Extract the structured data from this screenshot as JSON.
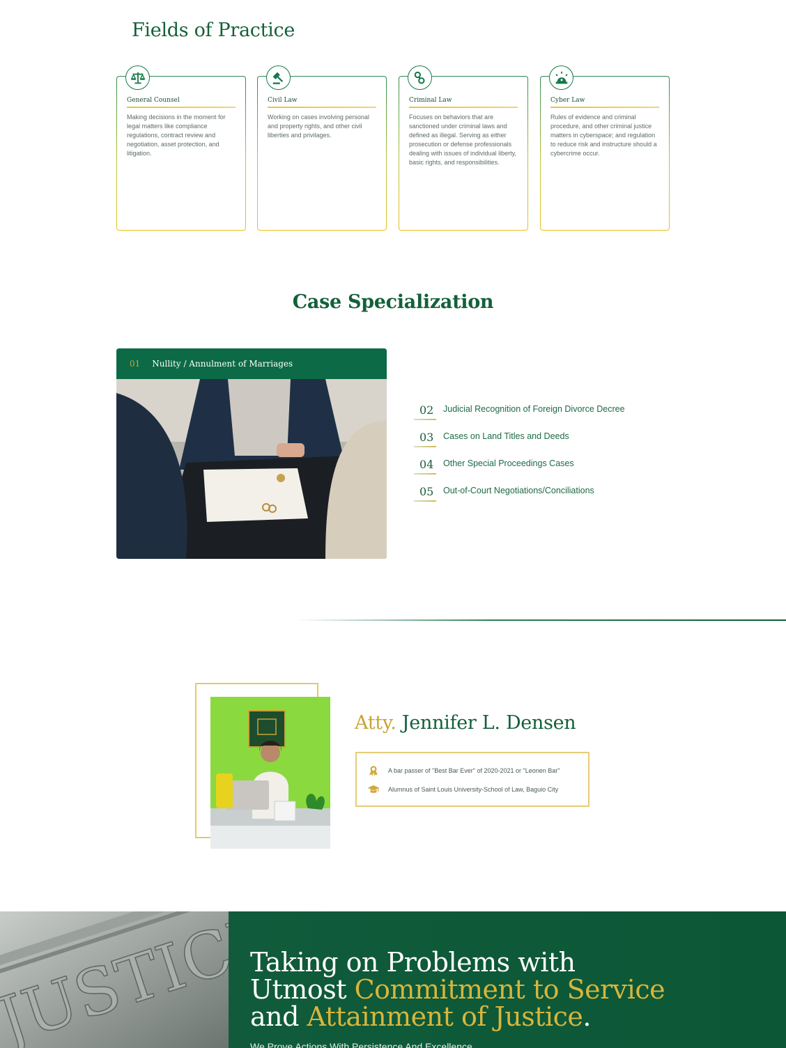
{
  "fields_of_practice": {
    "title": "Fields of Practice",
    "cards": [
      {
        "icon": "scales-icon",
        "title": "General Counsel",
        "text": "Making decisions in the moment for legal matters like compliance regulations, contract review and negotiation, asset protection, and litigation."
      },
      {
        "icon": "gavel-icon",
        "title": "Civil Law",
        "text": "Working on cases involving personal and property rights, and other civil liberties and privilages."
      },
      {
        "icon": "handcuffs-icon",
        "title": "Criminal Law",
        "text": "Focuses on behaviors that are sanctioned under criminal laws and defined as illegal. Serving as either prosecution or defense professionals dealing with issues of individual liberty, basic rights, and responsibilities."
      },
      {
        "icon": "alarm-siren-icon",
        "title": "Cyber Law",
        "text": "Rules of evidence and criminal procedure, and other criminal justice matters in cyberspace; and regulation to reduce risk and instructure should a cybercrime occur."
      }
    ]
  },
  "case_specialization": {
    "title": "Case Specialization",
    "active": {
      "number": "01",
      "label": "Nullity / Annulment of Marriages"
    },
    "items": [
      {
        "number": "02",
        "label": "Judicial Recognition of Foreign Divorce Decree"
      },
      {
        "number": "03",
        "label": "Cases on Land Titles and Deeds"
      },
      {
        "number": "04",
        "label": "Other Special Proceedings Cases"
      },
      {
        "number": "05",
        "label": "Out-of-Court Negotiations/Conciliations"
      }
    ]
  },
  "attorney": {
    "prefix": "Atty.",
    "name": "Jennifer L. Densen",
    "credentials": [
      {
        "icon": "award-ribbon-icon",
        "text": "A bar passer of \"Best Bar Ever\" of 2020-2021 or \"Leonen Bar\""
      },
      {
        "icon": "graduation-cap-icon",
        "text": "Alumnus of Saint Louis University-School of Law, Baguio City"
      }
    ]
  },
  "banner": {
    "line1": "Taking on Problems with",
    "line2_a": "Utmost ",
    "line2_b": "Commitment to Service",
    "line3_a": "and ",
    "line3_b": "Attainment of Justice",
    "line3_c": ".",
    "subtitle": "We Prove Actions With Persistence And Excellence",
    "stone_text": "JUSTICE"
  },
  "colors": {
    "brand_green": "#0c6a47",
    "gold": "#c8a433",
    "card_border_top": "#2b8a4f",
    "card_border_bottom": "#e7c21c"
  }
}
